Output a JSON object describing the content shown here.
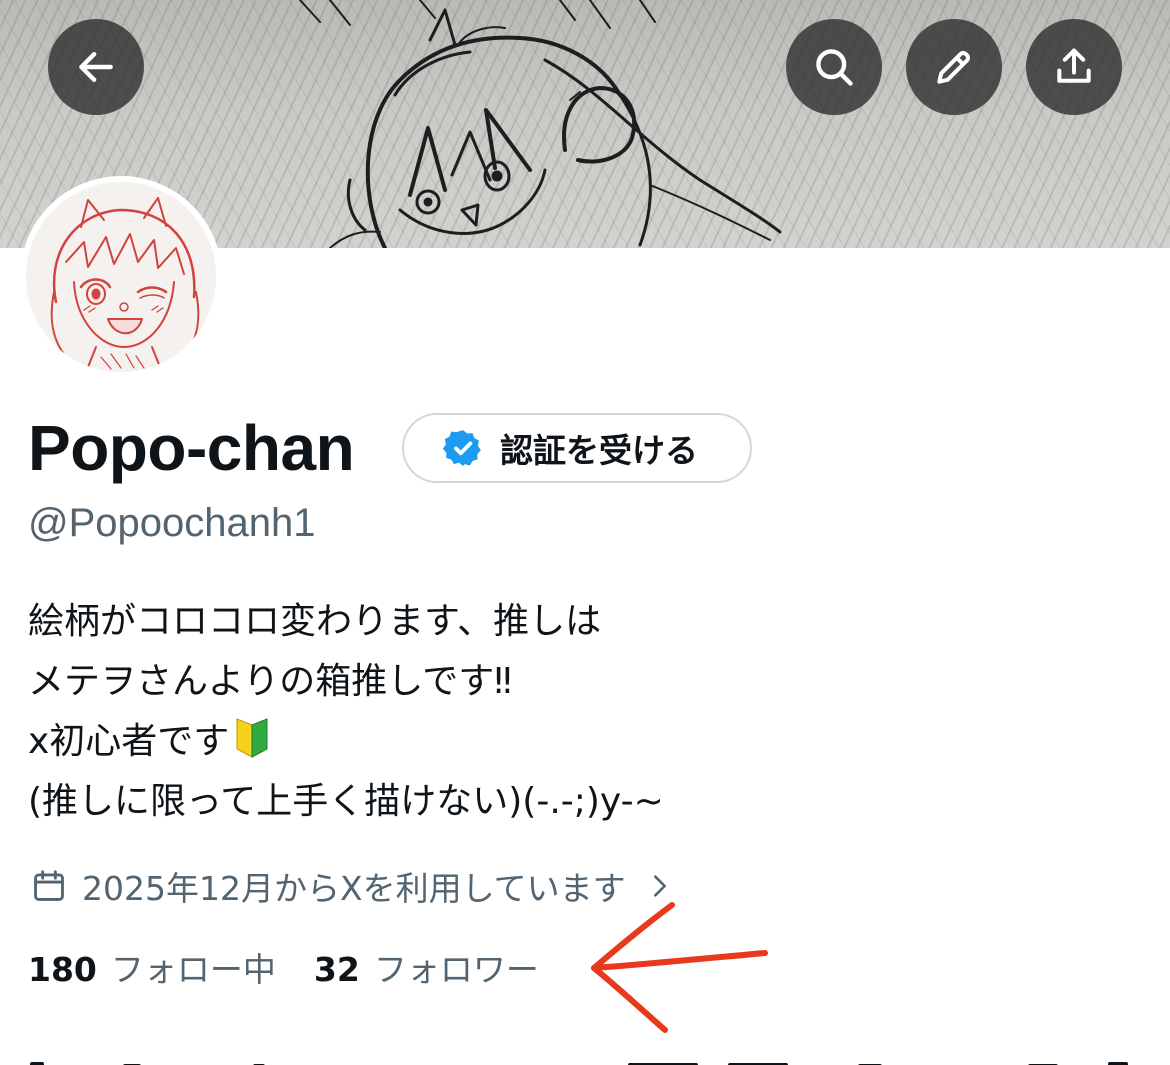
{
  "profile": {
    "display_name": "Popo-chan",
    "handle": "@Popoochanh1",
    "verify_label": "認証を受ける",
    "bio": {
      "line1": "絵柄がコロコロ変わります、推しは",
      "line2": "メテヲさんよりの箱推しです‼︎",
      "line3": "x初心者です",
      "line4": "(推しに限って上手く描けない)(-.-;)y-~"
    },
    "joined": "2025年12月からXを利用しています",
    "following_count": "180",
    "following_label": "フォロー中",
    "followers_count": "32",
    "followers_label": "フォロワー"
  },
  "icons": {
    "back": "arrow-left-icon",
    "search": "search-icon",
    "edit": "pencil-icon",
    "share": "share-upload-icon",
    "verified": "verified-badge-icon",
    "calendar": "calendar-icon",
    "chevron": "chevron-right-icon",
    "beginner": "beginner-mark-emoji"
  },
  "colors": {
    "text_primary": "#0f1419",
    "text_secondary": "#536471",
    "verified_blue": "#1d9bf0",
    "annotation_red": "#e8391e"
  }
}
